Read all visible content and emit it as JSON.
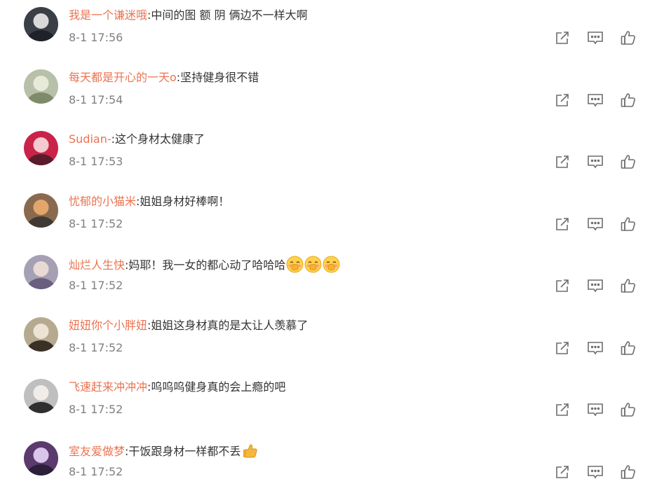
{
  "comments": [
    {
      "username": "我是一个谦迷哦",
      "text": "中间的图 额 阴 俩边不一样大啊",
      "time": "8-1 17:56",
      "emoji_count": 0
    },
    {
      "username": "每天都是开心的一天o",
      "text": "坚持健身很不错",
      "time": "8-1 17:54",
      "emoji_count": 0
    },
    {
      "username": "Sudian-",
      "text": "这个身材太健康了",
      "time": "8-1 17:53",
      "emoji_count": 0
    },
    {
      "username": "忧郁的小猫米",
      "text": "姐姐身材好棒啊！",
      "time": "8-1 17:52",
      "emoji_count": 0
    },
    {
      "username": "灿烂人生快",
      "text": "妈耶！我一女的都心动了哈哈哈",
      "time": "8-1 17:52",
      "emoji_count": 3,
      "emoji_icon": "shy-face-emoji"
    },
    {
      "username": "妞妞你个小胖妞",
      "text": "姐姐这身材真的是太让人羡慕了",
      "time": "8-1 17:52",
      "emoji_count": 0
    },
    {
      "username": "飞速赶来冲冲冲",
      "text": "呜呜呜健身真的会上瘾的吧",
      "time": "8-1 17:52",
      "emoji_count": 0
    },
    {
      "username": "室友爱做梦",
      "text": "干饭跟身材一样都不丢",
      "time": "8-1 17:52",
      "emoji_count": 1,
      "emoji_icon": "thumbs-up-emoji"
    }
  ],
  "colors": {
    "username": "#eb7350",
    "text": "#333333",
    "time": "#808080",
    "icon": "#6d6d6d"
  },
  "action_icons": [
    "share-icon",
    "reply-icon",
    "like-icon"
  ]
}
